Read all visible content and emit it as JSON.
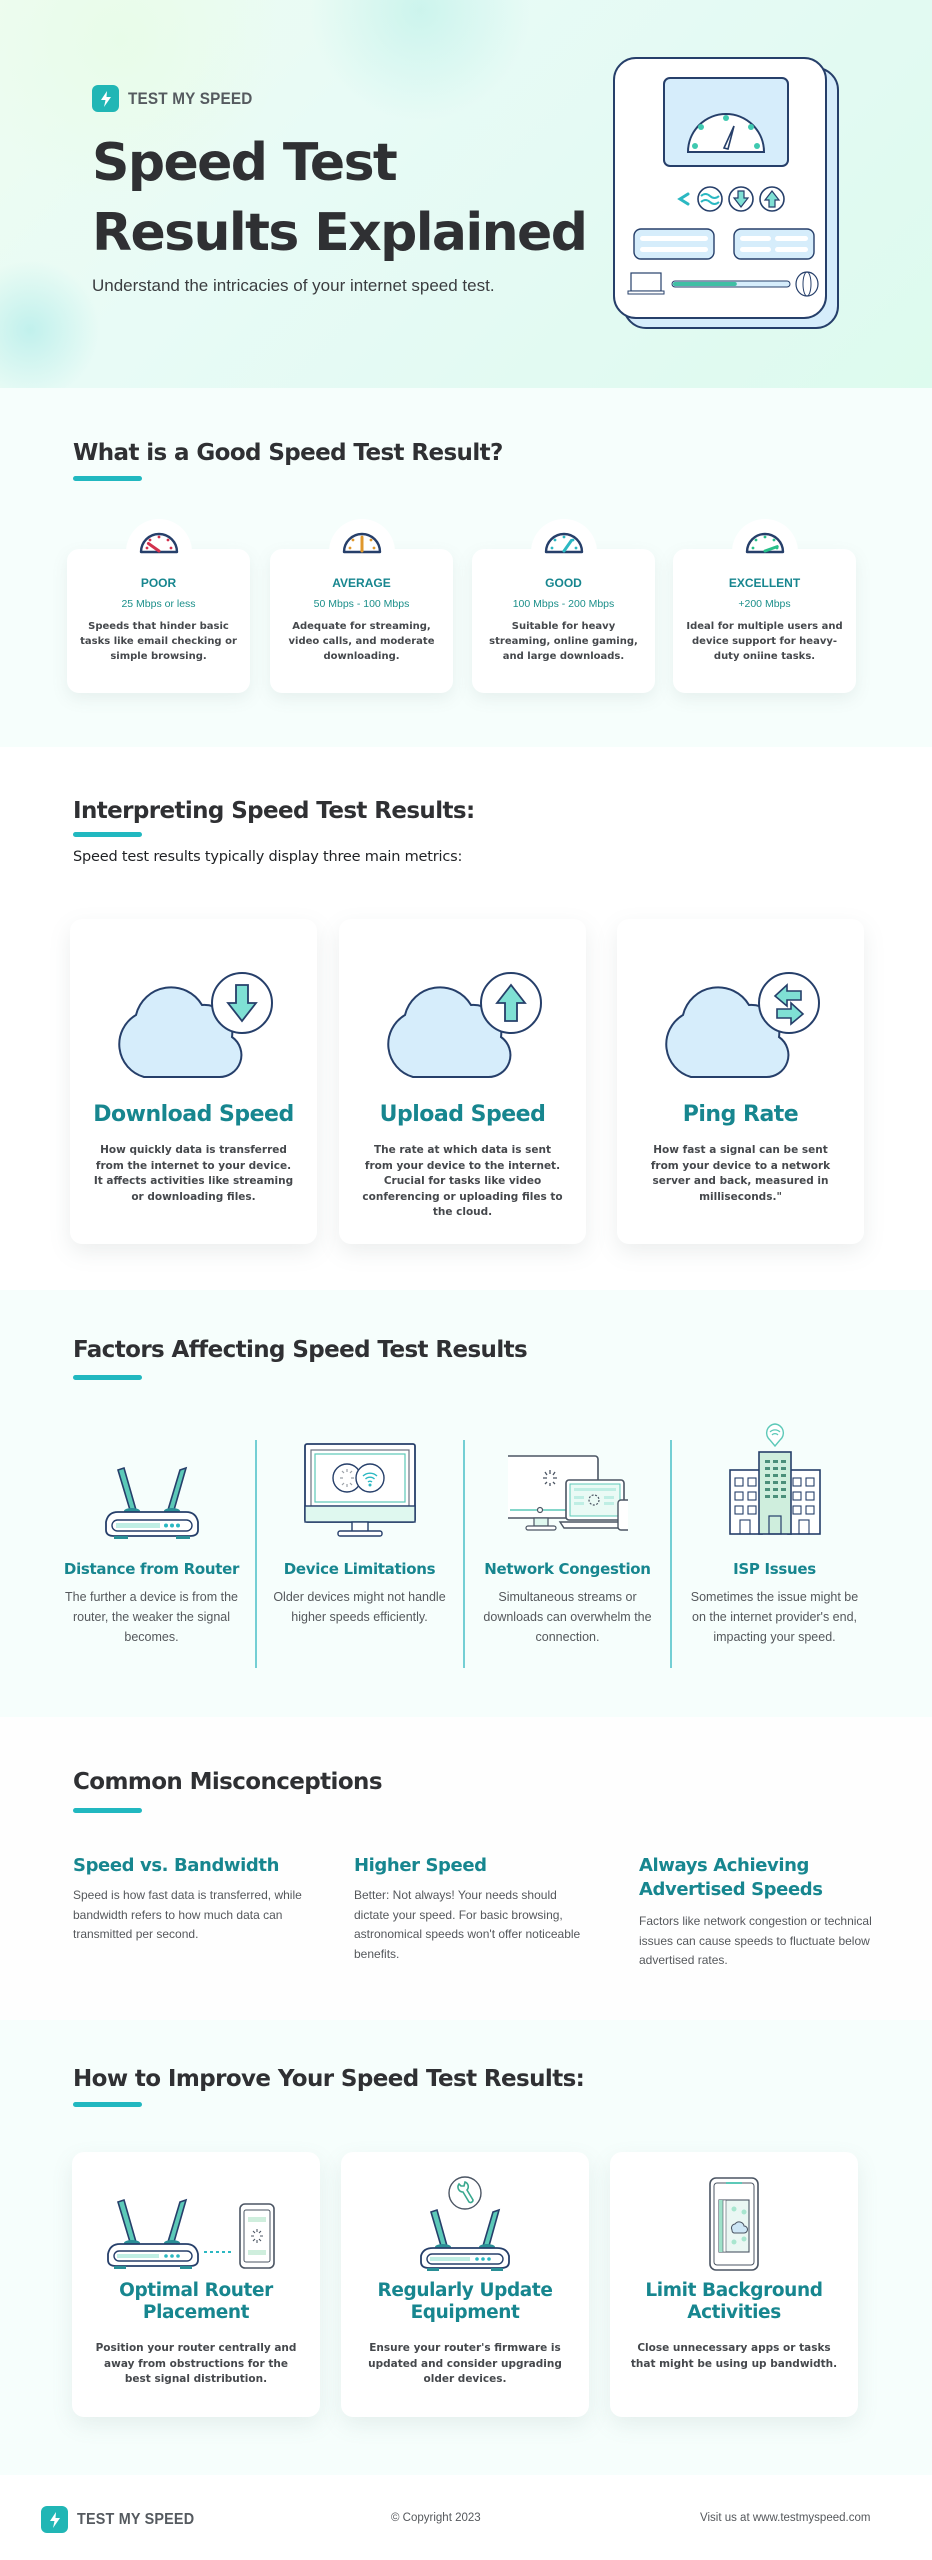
{
  "brand": {
    "name": "TEST MY SPEED",
    "icon": "lightning-bolt-icon",
    "accent_color": "#21b6b5"
  },
  "hero": {
    "title_line_1": "Speed Test",
    "title_line_2": "Results Explained",
    "subtitle": "Understand the intricacies of your internet speed test.",
    "illustration": "speed-test-device-illustration",
    "illustration_progress": 0.55
  },
  "good_result": {
    "heading": "What is a Good Speed Test Result?",
    "ratings": [
      {
        "label": "POOR",
        "range": "25 Mbps or less",
        "description": "Speeds that hinder basic tasks like email checking or simple browsing.",
        "gauge_color": "#d2314d",
        "icon": "gauge-low-icon"
      },
      {
        "label": "AVERAGE",
        "range": "50 Mbps - 100 Mbps",
        "description": "Adequate for streaming, video calls, and moderate downloading.",
        "gauge_color": "#e0982c",
        "icon": "gauge-mid-icon"
      },
      {
        "label": "GOOD",
        "range": "100 Mbps - 200 Mbps",
        "description": "Suitable for heavy streaming, online gaming, and large downloads.",
        "gauge_color": "#2bb8c2",
        "icon": "gauge-high-icon"
      },
      {
        "label": "EXCELLENT",
        "range": "+200 Mbps",
        "description": "Ideal for multiple users and device support for heavy-duty oniine tasks.",
        "gauge_color": "#28c08a",
        "icon": "gauge-max-icon"
      }
    ]
  },
  "interpreting": {
    "heading": "Interpreting Speed Test Results:",
    "intro": "Speed test results typically display three main metrics:",
    "metrics": [
      {
        "title": "Download Speed",
        "description": "How quickly data is transferred from the internet to your device. It affects activities like streaming or downloading files.",
        "icon": "cloud-download-icon"
      },
      {
        "title": "Upload Speed",
        "description": "The rate at which data is sent from your device to the internet. Crucial for tasks like video conferencing or uploading files to the cloud.",
        "icon": "cloud-upload-icon"
      },
      {
        "title": "Ping Rate",
        "description": "How fast a signal can be sent from your device to a network server and back, measured in milliseconds.\"",
        "icon": "cloud-exchange-icon"
      }
    ]
  },
  "factors": {
    "heading": "Factors Affecting Speed Test Results",
    "items": [
      {
        "title": "Distance from Router",
        "description": "The further a device is from the router, the weaker the signal becomes.",
        "icon": "router-icon"
      },
      {
        "title": "Device Limitations",
        "description": "Older devices might not handle higher speeds efficiently.",
        "icon": "monitor-loading-icon"
      },
      {
        "title": "Network Congestion",
        "description": "Simultaneous streams or downloads can overwhelm the connection.",
        "icon": "multiple-devices-icon"
      },
      {
        "title": "ISP Issues",
        "description": "Sometimes the issue might be on the internet provider's end, impacting your speed.",
        "icon": "isp-building-icon"
      }
    ]
  },
  "misconceptions": {
    "heading": "Common Misconceptions",
    "items": [
      {
        "title": "Speed vs. Bandwidth",
        "description": "Speed is how fast data is transferred, while bandwidth refers to how much data can transmitted per second."
      },
      {
        "title": "Higher Speed",
        "description": "Better: Not always! Your needs should dictate your speed. For basic browsing, astronomical speeds won't offer noticeable benefits."
      },
      {
        "title_line_1": "Always Achieving",
        "title_line_2": "Advertised Speeds",
        "description": "Factors like network congestion or technical issues can cause speeds to fluctuate below advertised rates."
      }
    ]
  },
  "improve": {
    "heading": "How to Improve Your Speed Test Results:",
    "tips": [
      {
        "title_line_1": "Optimal Router",
        "title_line_2": "Placement",
        "description": "Position your router centrally and away from obstructions for the best signal distribution.",
        "icon": "router-phone-icon"
      },
      {
        "title_line_1": "Regularly Update",
        "title_line_2": "Equipment",
        "description": "Ensure your router's firmware is updated and consider upgrading older devices.",
        "icon": "router-wrench-icon"
      },
      {
        "title_line_1": "Limit Background",
        "title_line_2": "Activities",
        "description": "Close unnecessary apps or tasks that might be using up bandwidth.",
        "icon": "phone-apps-icon"
      }
    ]
  },
  "footer": {
    "copyright": "© Copyright 2023",
    "visit": "Visit us at www.testmyspeed.com"
  }
}
